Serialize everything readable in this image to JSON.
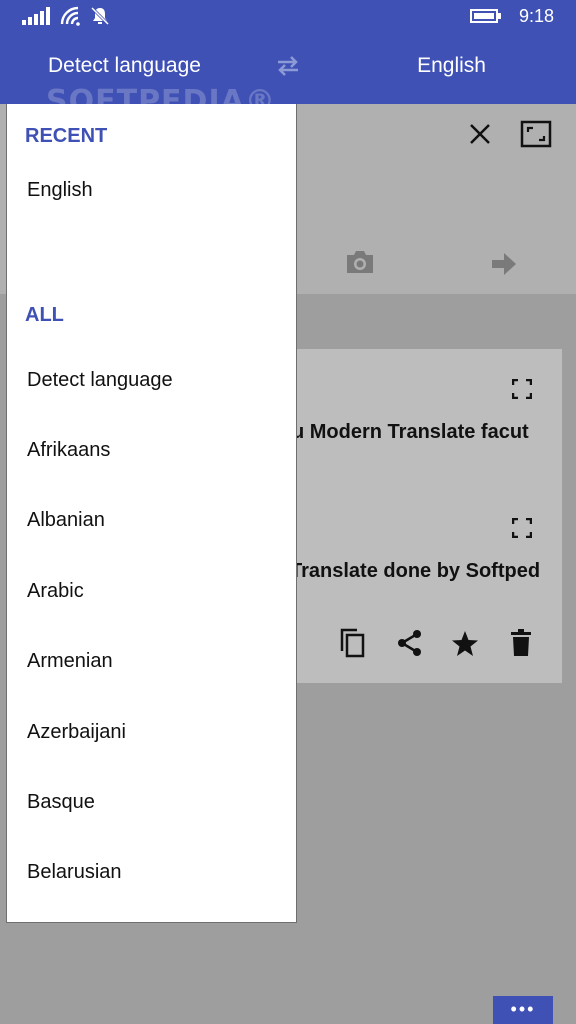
{
  "status_bar": {
    "time": "9:18",
    "icons": [
      "signal-icon",
      "wifi-icon",
      "notifications-off-icon",
      "battery-icon"
    ]
  },
  "header": {
    "source_language": "Detect language",
    "target_language": "English",
    "watermark": "SOFTPEDIA®",
    "swap_icon": "swap-arrows-icon"
  },
  "input_area": {
    "icons": [
      "close-icon",
      "fullscreen-icon",
      "camera-icon",
      "arrow-right-icon"
    ]
  },
  "result_card": {
    "source_text": "u Modern Translate facut",
    "translated_text": "Translate done by Softped",
    "icons": [
      "expand-icon",
      "copy-icon",
      "share-icon",
      "star-icon",
      "delete-icon"
    ]
  },
  "dropdown": {
    "recent_header": "RECENT",
    "recent_items": [
      "English"
    ],
    "all_header": "ALL",
    "all_items": [
      "Detect language",
      "Afrikaans",
      "Albanian",
      "Arabic",
      "Armenian",
      "Azerbaijani",
      "Basque",
      "Belarusian"
    ]
  },
  "app_bar": {
    "more_label": "•••"
  },
  "colors": {
    "accent": "#3f51b5",
    "overlay": "#9e9e9e"
  }
}
